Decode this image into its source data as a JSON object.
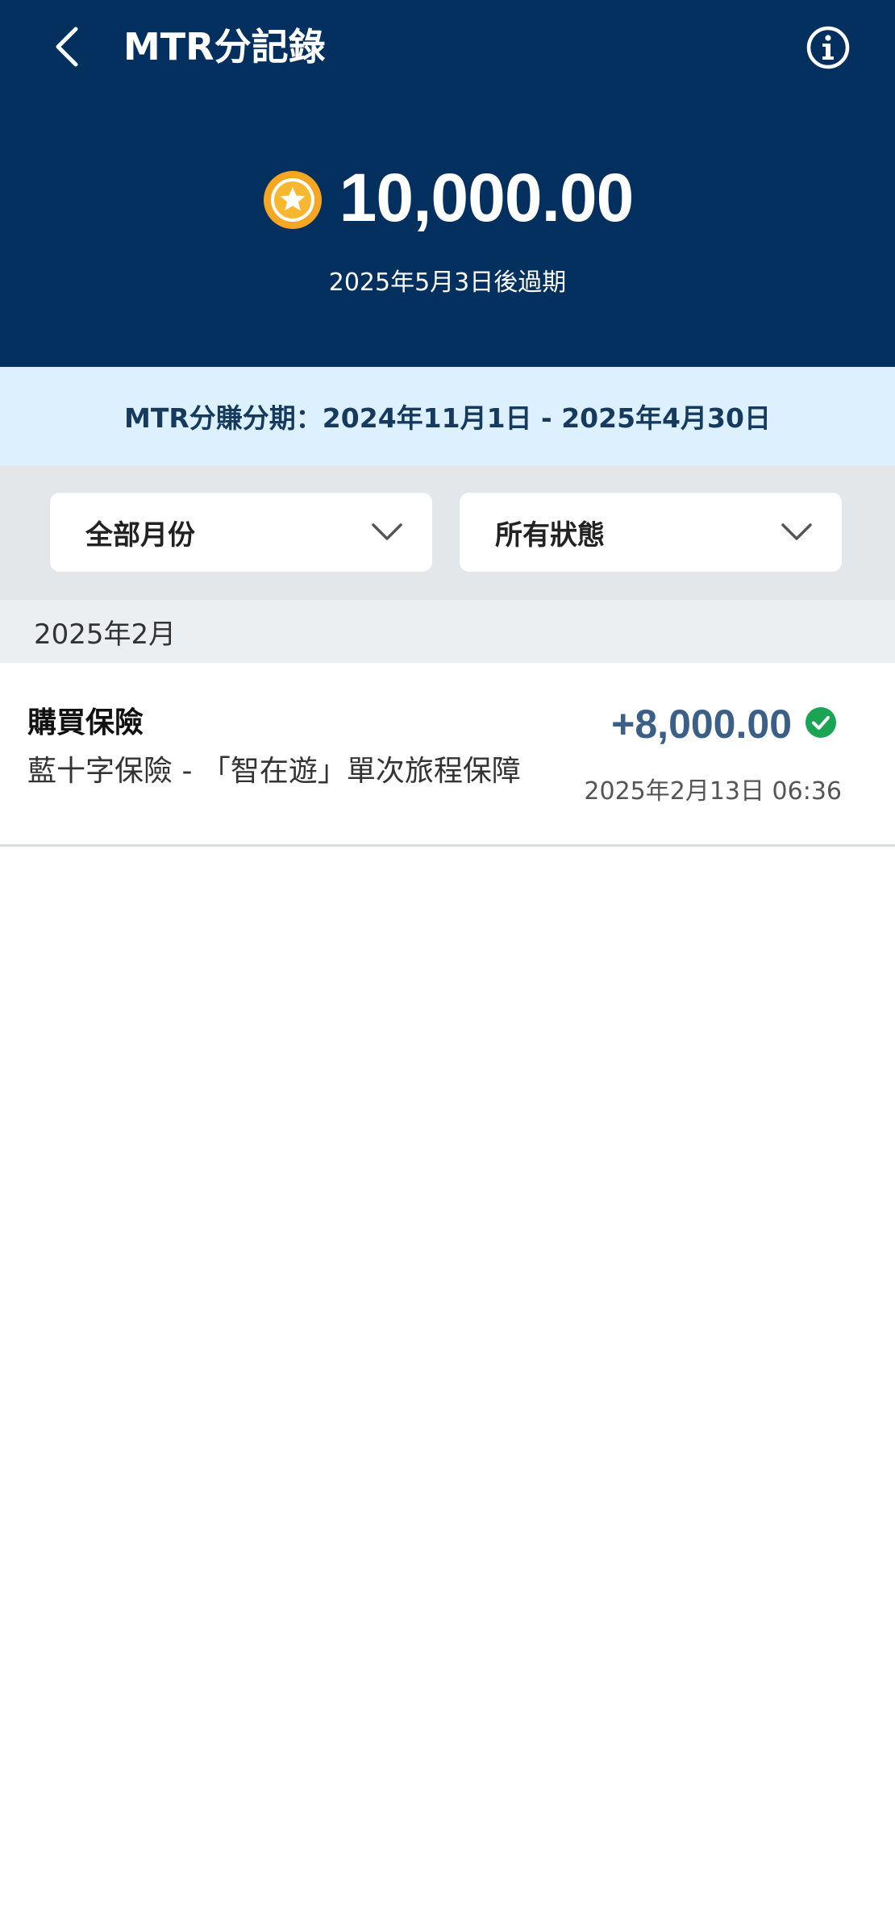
{
  "header": {
    "title": "MTR分記錄",
    "back_icon": "chevron-left-icon",
    "info_icon": "info-icon",
    "background_color": "#03305e"
  },
  "balance": {
    "value": "10,000.00",
    "coin_icon": "star-coin-icon",
    "expiry": "2025年5月3日後過期"
  },
  "period": {
    "text": "MTR分賺分期：2024年11月1日 - 2025年4月30日"
  },
  "filters": {
    "month": {
      "label": "全部月份",
      "icon": "chevron-down-icon"
    },
    "status": {
      "label": "所有狀態",
      "icon": "chevron-down-icon"
    }
  },
  "sections": [
    {
      "month": "2025年2月",
      "records": [
        {
          "type": "購買保險",
          "description": "藍十字保險 - 「智在遊」單次旅程保障",
          "amount": "+8,000.00",
          "status_icon": "check-circle-icon",
          "timestamp": "2025年2月13日 06:36"
        }
      ]
    }
  ],
  "colors": {
    "accent_amount": "#3b5f86",
    "success": "#1aa454",
    "coin": "#f5a623",
    "banner_bg": "#dcf1fd"
  }
}
